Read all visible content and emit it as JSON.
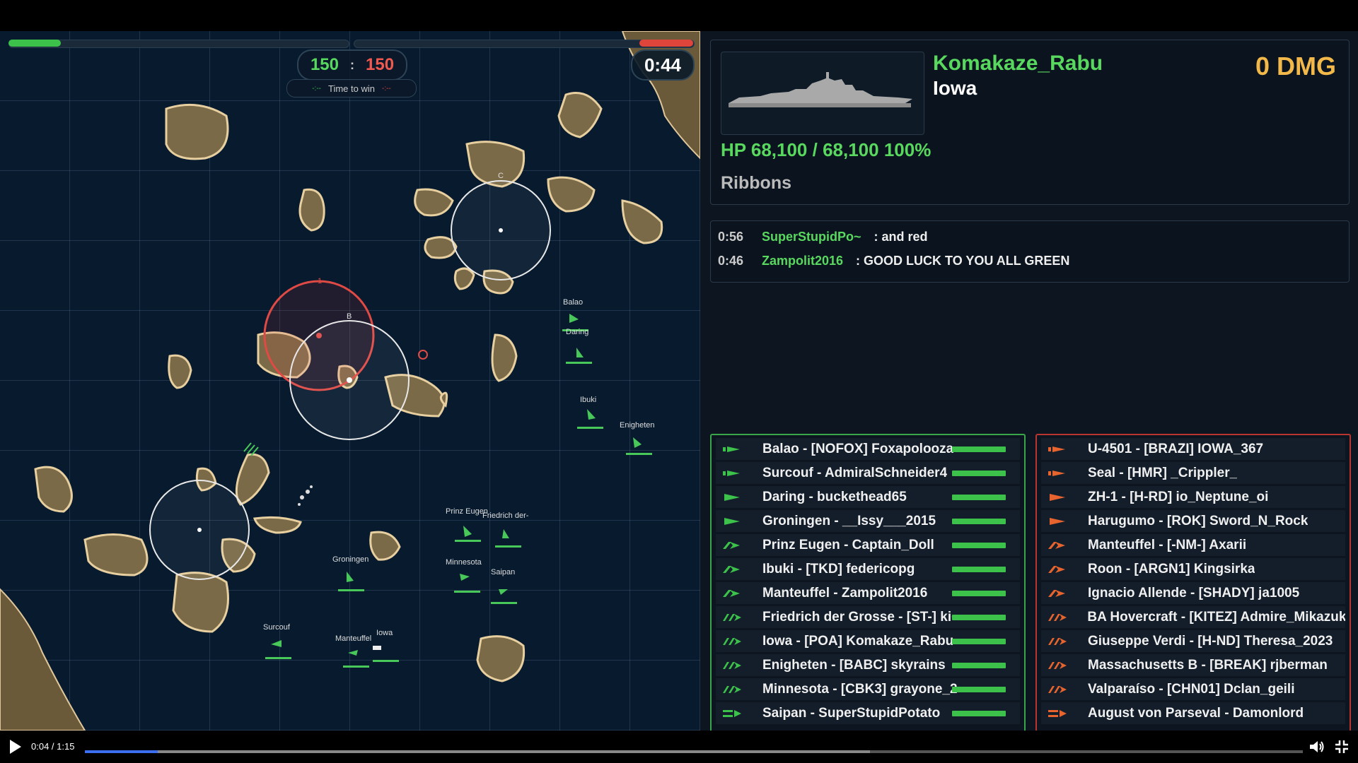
{
  "map": {
    "score_green": "150",
    "score_sep": ":",
    "score_red": "150",
    "time_to_win_label": "Time to win",
    "time_to_win_green": "-:--",
    "time_to_win_red": "-:--",
    "timer": "0:44",
    "cap_labels": {
      "a": "1",
      "b": "B",
      "c": "C"
    },
    "hp_green_fraction": 0.15,
    "hp_red_fraction": 0.16,
    "ship_labels": [
      "Balao",
      "Daring",
      "Ibuki",
      "Enigheten",
      "Prinz Eugen",
      "Friedrich der-",
      "Groningen",
      "Minnesota",
      "Saipan",
      "Surcouf",
      "Manteuffel",
      "Iowa"
    ]
  },
  "info": {
    "player_name": "Komakaze_Rabu",
    "ship_name": "Iowa",
    "damage": "0 DMG",
    "hp": "HP 68,100 / 68,100  100%",
    "ribbons_label": "Ribbons"
  },
  "chat": [
    {
      "time": "0:56",
      "name": "SuperStupidPo~",
      "msg": ": and red"
    },
    {
      "time": "0:46",
      "name": "Zampolit2016",
      "msg": ": GOOD LUCK TO YOU ALL GREEN"
    }
  ],
  "team_green": [
    {
      "label": "Balao - [NOFOX] Foxapolooza",
      "icon": "submarine-icon"
    },
    {
      "label": "Surcouf - AdmiralSchneider4",
      "icon": "submarine-icon"
    },
    {
      "label": "Daring - buckethead65",
      "icon": "destroyer-icon"
    },
    {
      "label": "Groningen - __Issy___2015",
      "icon": "destroyer-icon"
    },
    {
      "label": "Prinz Eugen - Captain_Doll",
      "icon": "cruiser-icon"
    },
    {
      "label": "Ibuki - [TKD] federicopg",
      "icon": "cruiser-icon"
    },
    {
      "label": "Manteuffel - Zampolit2016",
      "icon": "cruiser-icon"
    },
    {
      "label": "Friedrich der Grosse - [ST-] ki~",
      "icon": "battleship-icon"
    },
    {
      "label": "Iowa - [POA] Komakaze_Rabu",
      "icon": "battleship-icon"
    },
    {
      "label": "Enigheten - [BABC] skyrains",
      "icon": "battleship-icon"
    },
    {
      "label": "Minnesota - [CBK3] grayone_2",
      "icon": "battleship-icon"
    },
    {
      "label": "Saipan - SuperStupidPotato",
      "icon": "carrier-icon"
    }
  ],
  "team_red": [
    {
      "label": "U-4501 - [BRAZI] IOWA_367",
      "icon": "submarine-icon"
    },
    {
      "label": "Seal - [HMR] _Crippler_",
      "icon": "submarine-icon"
    },
    {
      "label": "ZH-1 - [H-RD] io_Neptune_oi",
      "icon": "destroyer-icon"
    },
    {
      "label": "Harugumo - [ROK] Sword_N_Rock",
      "icon": "destroyer-icon"
    },
    {
      "label": "Manteuffel - [-NM-] Axarii",
      "icon": "cruiser-icon"
    },
    {
      "label": "Roon - [ARGN1] Kingsirka",
      "icon": "cruiser-icon"
    },
    {
      "label": "Ignacio Allende - [SHADY] ja1005",
      "icon": "cruiser-icon"
    },
    {
      "label": "BA Hovercraft - [KITEZ] Admire_Mikazuki",
      "icon": "battleship-icon"
    },
    {
      "label": "Giuseppe Verdi - [H-ND] Theresa_2023",
      "icon": "battleship-icon"
    },
    {
      "label": "Massachusetts B - [BREAK] rjberman",
      "icon": "battleship-icon"
    },
    {
      "label": "Valparaíso - [CHN01] Dclan_geili",
      "icon": "battleship-icon"
    },
    {
      "label": "August von Parseval - Damonlord",
      "icon": "carrier-icon"
    }
  ],
  "colors": {
    "green": "#3cc14b",
    "red": "#e0453c",
    "dmg": "#f2b84a",
    "accent": "#3b6ef0"
  },
  "player": {
    "time": "0:04 / 1:15",
    "played_fraction": 0.06
  }
}
